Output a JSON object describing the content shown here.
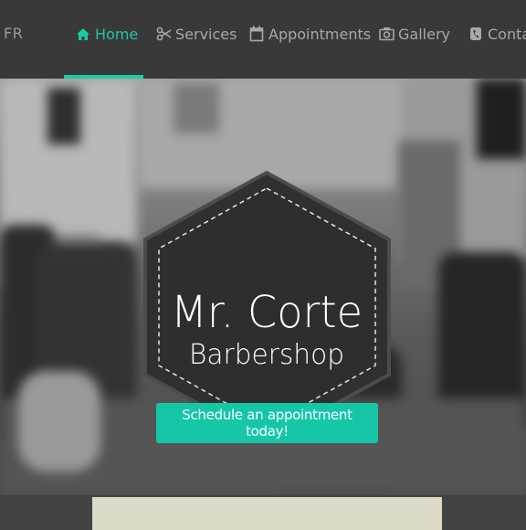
{
  "nav": {
    "lang": "FR",
    "items": [
      {
        "label": "Home",
        "icon": "home-icon",
        "active": true
      },
      {
        "label": "Services",
        "icon": "scissors-icon"
      },
      {
        "label": "Appointments",
        "icon": "calendar-icon"
      },
      {
        "label": "Gallery",
        "icon": "camera-icon"
      },
      {
        "label": "Contac",
        "icon": "phone-icon"
      }
    ]
  },
  "hero": {
    "title": "Mr. Corte",
    "subtitle": "Barbershop",
    "cta": "Schedule an appointment today!"
  },
  "colors": {
    "accent": "#1ec9a8",
    "nav_bg": "#393939"
  }
}
